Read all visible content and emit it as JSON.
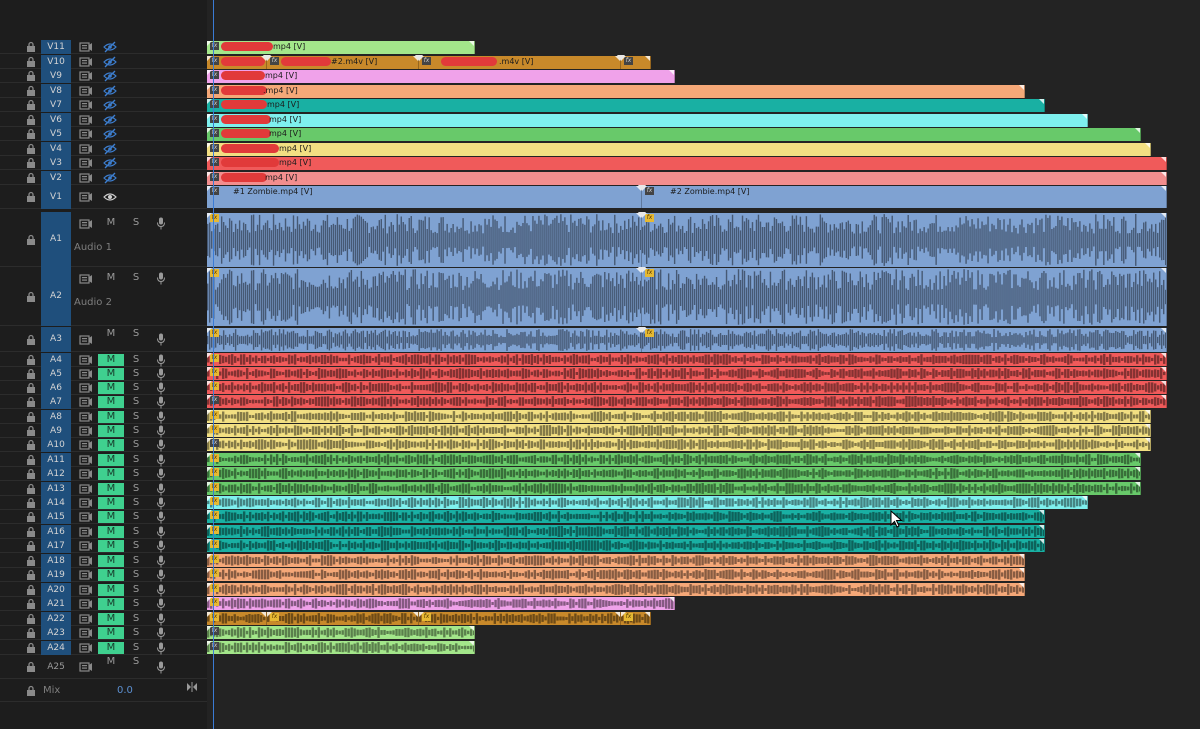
{
  "video_tracks": [
    {
      "label": "V11"
    },
    {
      "label": "V10"
    },
    {
      "label": "V9"
    },
    {
      "label": "V8"
    },
    {
      "label": "V7"
    },
    {
      "label": "V6"
    },
    {
      "label": "V5"
    },
    {
      "label": "V4"
    },
    {
      "label": "V3"
    },
    {
      "label": "V2"
    },
    {
      "label": "V1"
    }
  ],
  "audio_tracks": [
    {
      "label": "A1",
      "name": "Audio 1",
      "mute": "M",
      "solo": "S"
    },
    {
      "label": "A2",
      "name": "Audio 2",
      "mute": "M",
      "solo": "S"
    },
    {
      "label": "A3",
      "mute": "M",
      "solo": "S"
    },
    {
      "label": "A4",
      "mute": "M",
      "solo": "S"
    },
    {
      "label": "A5",
      "mute": "M",
      "solo": "S"
    },
    {
      "label": "A6",
      "mute": "M",
      "solo": "S"
    },
    {
      "label": "A7",
      "mute": "M",
      "solo": "S"
    },
    {
      "label": "A8",
      "mute": "M",
      "solo": "S"
    },
    {
      "label": "A9",
      "mute": "M",
      "solo": "S"
    },
    {
      "label": "A10",
      "mute": "M",
      "solo": "S"
    },
    {
      "label": "A11",
      "mute": "M",
      "solo": "S"
    },
    {
      "label": "A12",
      "mute": "M",
      "solo": "S"
    },
    {
      "label": "A13",
      "mute": "M",
      "solo": "S"
    },
    {
      "label": "A14",
      "mute": "M",
      "solo": "S"
    },
    {
      "label": "A15",
      "mute": "M",
      "solo": "S"
    },
    {
      "label": "A16",
      "mute": "M",
      "solo": "S"
    },
    {
      "label": "A17",
      "mute": "M",
      "solo": "S"
    },
    {
      "label": "A18",
      "mute": "M",
      "solo": "S"
    },
    {
      "label": "A19",
      "mute": "M",
      "solo": "S"
    },
    {
      "label": "A20",
      "mute": "M",
      "solo": "S"
    },
    {
      "label": "A21",
      "mute": "M",
      "solo": "S"
    },
    {
      "label": "A22",
      "mute": "M",
      "solo": "S"
    },
    {
      "label": "A23",
      "mute": "M",
      "solo": "S"
    },
    {
      "label": "A24",
      "mute": "M",
      "solo": "S"
    },
    {
      "label": "A25",
      "mute": "M",
      "solo": "S"
    }
  ],
  "mix": {
    "label": "Mix",
    "value": "0.0"
  },
  "clips": {
    "v11_1": "mp4 [V]",
    "v10_1": "#2.m4v [V]",
    "v10_2": ".m4v [V]",
    "v9_1": "mp4 [V]",
    "v8_1": ".mp4 [V]",
    "v7_1": "mp4 [V]",
    "v6_1": "mp4 [V]",
    "v5_1": "mp4 [V]",
    "v4_1": "mp4 [V]",
    "v3_1": "mp4 [V]",
    "v2_1": "mp4 [V]",
    "v1_1": "#1 Zombie.mp4 [V]",
    "v1_2": "#2 Zombie.mp4 [V]"
  },
  "fx_label": "fx",
  "colors": {
    "track_label_bg": "#1f4f7c",
    "mute_on": "#3fd08f",
    "playhead": "#3a7bd5",
    "v11": "#a3e68a",
    "v10": "#c8892a",
    "v9": "#f0a2ea",
    "v8": "#f5a878",
    "v7": "#19b0a3",
    "v6": "#7ef0ee",
    "v5": "#68c96a",
    "v4": "#f2df82",
    "v3": "#f05a5a",
    "v2": "#f28e8e",
    "v1": "#7fa2d2"
  }
}
